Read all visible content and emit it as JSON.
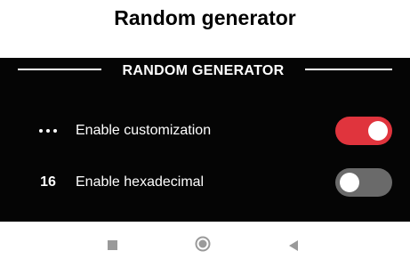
{
  "page": {
    "title": "Random generator"
  },
  "section": {
    "title": "RANDOM GENERATOR"
  },
  "rows": [
    {
      "icon": "more-dots-icon",
      "label": "Enable customization",
      "toggle": "on"
    },
    {
      "icon_text": "16",
      "label": "Enable hexadecimal",
      "toggle": "off"
    }
  ],
  "colors": {
    "panel_background": "#050505",
    "toggle_on": "#e0343d",
    "toggle_off": "#6a6a6a",
    "nav_icons": "#9a9a9a"
  },
  "nav": {
    "icons": [
      "recents-square-icon",
      "home-circle-icon",
      "back-triangle-icon"
    ]
  }
}
